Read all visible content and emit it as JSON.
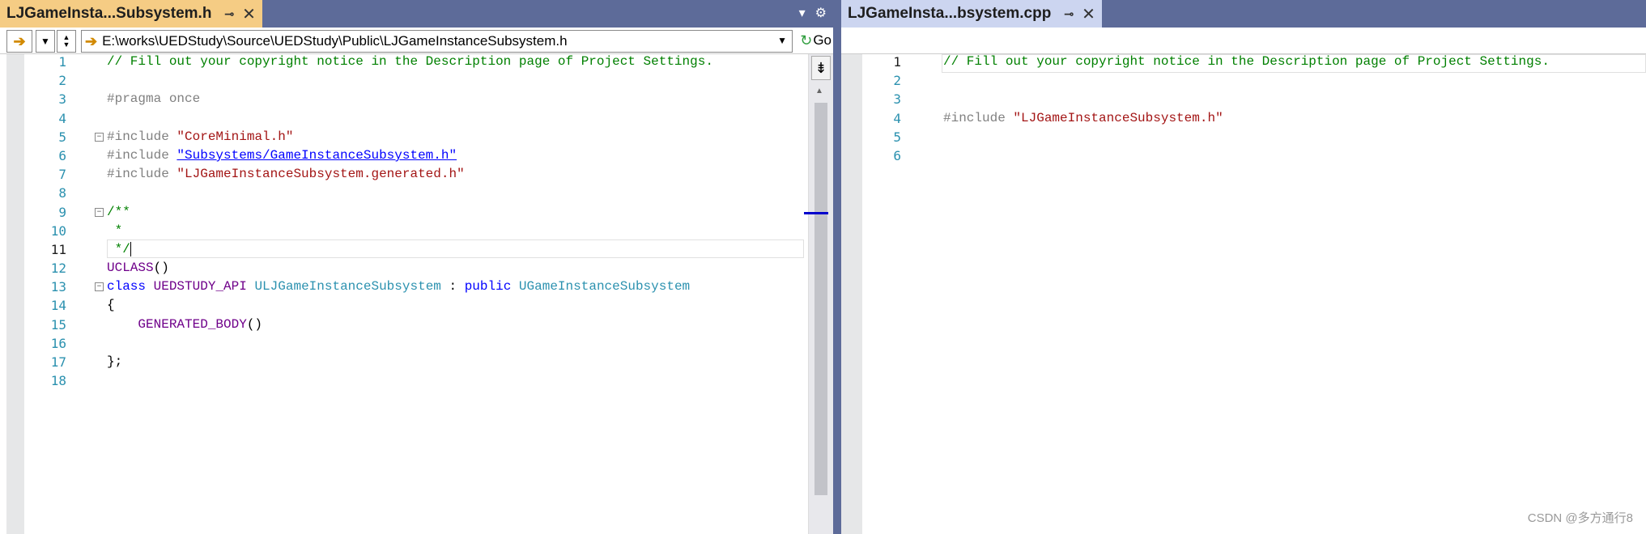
{
  "left_pane": {
    "tab": {
      "name": "LJGameInsta...Subsystem.h",
      "pin": "⊸",
      "close": "✕"
    },
    "strip_icons": {
      "dropdown": "▾",
      "settings": "⚙"
    },
    "nav": {
      "back_icon": "➔",
      "path": "E:\\works\\UEDStudy\\Source\\UEDStudy\\Public\\LJGameInstanceSubsystem.h",
      "go_label": "Go"
    },
    "line_numbers": [
      "1",
      "2",
      "3",
      "4",
      "5",
      "6",
      "7",
      "8",
      "9",
      "10",
      "11",
      "12",
      "13",
      "14",
      "15",
      "16",
      "17",
      "18"
    ],
    "current_line": "11"
  },
  "right_pane": {
    "tab": {
      "name": "LJGameInsta...bsystem.cpp",
      "pin": "⊸",
      "close": "✕"
    },
    "line_numbers": [
      "1",
      "2",
      "3",
      "4",
      "5",
      "6"
    ],
    "current_line": "1"
  },
  "code_left": {
    "l1": "// Fill out your copyright notice in the Description page of Project Settings.",
    "l3": "#pragma once",
    "l5_pre": "#include ",
    "l5_str": "\"CoreMinimal.h\"",
    "l6_pre": "#include ",
    "l6_str": "\"Subsystems/GameInstanceSubsystem.h\"",
    "l7_pre": "#include ",
    "l7_str": "\"LJGameInstanceSubsystem.generated.h\"",
    "l9": "/**",
    "l10": " *",
    "l11": " */",
    "l12_mac": "UCLASS",
    "l12_rest": "()",
    "l13_kw": "class",
    "l13_api": "UEDSTUDY_API",
    "l13_cls": "ULJGameInstanceSubsystem",
    "l13_colon": " : ",
    "l13_pub": "public",
    "l13_base": "UGameInstanceSubsystem",
    "l14": "{",
    "l15_mac": "GENERATED_BODY",
    "l15_rest": "()",
    "l17": "};"
  },
  "code_right": {
    "l1": "// Fill out your copyright notice in the Description page of Project Settings.",
    "l4_pre": "#include ",
    "l4_str": "\"LJGameInstanceSubsystem.h\""
  },
  "watermark": "CSDN @多方通行8"
}
